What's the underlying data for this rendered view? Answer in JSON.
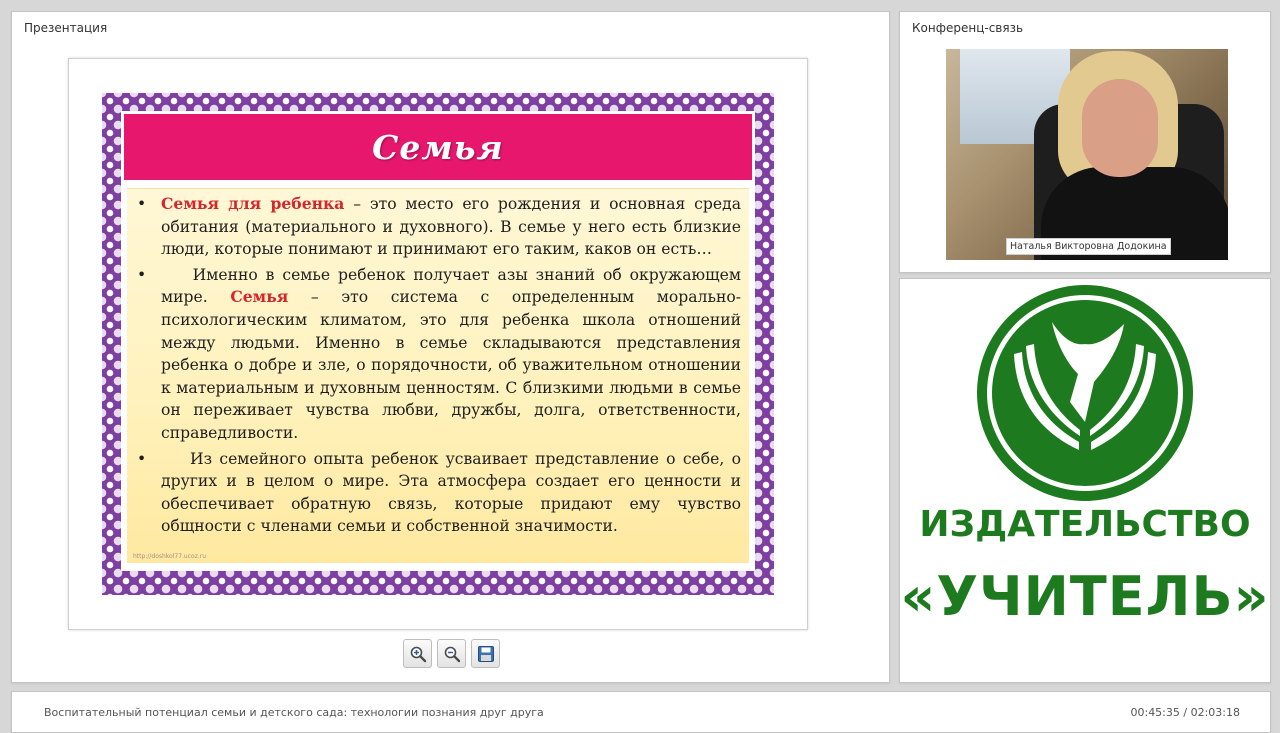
{
  "presentation": {
    "title": "Презентация"
  },
  "conference": {
    "title": "Конференц-связь",
    "participant_name": "Наталья Викторовна Додокина"
  },
  "slide": {
    "title": "Семья",
    "bullets": [
      {
        "highlight": "Семья для ребенка",
        "text": " – это место его рождения и основная среда обитания (материального и духовного). В семье у него есть близкие люди, которые понимают и принимают его таким, каков он есть…"
      },
      {
        "before": "Именно в семье ребенок получает азы знаний об окружающем мире. ",
        "highlight": "Семья",
        "text": " – это система с определенным морально-психологическим климатом, это для ребенка школа отношений между людьми. Именно в семье складываются представления ребенка о добре и зле, о порядочности, об уважительном отношении к материальным и духовным ценностям. С близкими людьми в семье он переживает чувства любви, дружбы, долга, ответственности, справедливости."
      },
      {
        "text": "Из семейного опыта ребенок усваивает представление о себе, о других и в целом о мире. Эта атмосфера создает его ценности и обеспечивает обратную связь, которые придают ему чувство общности с членами семьи и собственной значимости."
      }
    ],
    "bullet_char": "•",
    "url": "http://doshkol77.ucoz.ru"
  },
  "toolbar": {
    "icons": [
      "zoom-in-icon",
      "zoom-out-icon",
      "save-icon"
    ]
  },
  "publisher": {
    "name": "ИЗДАТЕЛЬСТВО",
    "brand": "«УЧИТЕЛЬ»",
    "color": "#1e7a1e"
  },
  "footer": {
    "title": "Воспитательный потенциал семьи и детского сада: технологии познания друг друга",
    "time": "00:45:35 / 02:03:18"
  }
}
